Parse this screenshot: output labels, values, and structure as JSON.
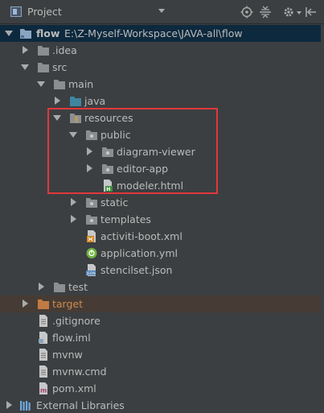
{
  "header": {
    "title": "Project",
    "tools": [
      "target-icon",
      "collapse-icon",
      "gear-icon",
      "hide-icon"
    ]
  },
  "tree": [
    {
      "label": "flow",
      "path": "E:\\Z-Myself-Workspace\\JAVA-all\\flow",
      "level": 0,
      "arrow": "down",
      "icon": "module-folder-icon"
    },
    {
      "label": ".idea",
      "level": 1,
      "arrow": "right",
      "icon": "folder-icon"
    },
    {
      "label": "src",
      "level": 1,
      "arrow": "down",
      "icon": "folder-icon"
    },
    {
      "label": "main",
      "level": 2,
      "arrow": "down",
      "icon": "folder-icon"
    },
    {
      "label": "java",
      "level": 3,
      "arrow": "right",
      "icon": "source-folder-icon"
    },
    {
      "label": "resources",
      "level": 3,
      "arrow": "down",
      "icon": "resources-folder-icon"
    },
    {
      "label": "public",
      "level": 4,
      "arrow": "down",
      "icon": "folder-icon"
    },
    {
      "label": "diagram-viewer",
      "level": 5,
      "arrow": "right",
      "icon": "folder-icon"
    },
    {
      "label": "editor-app",
      "level": 5,
      "arrow": "right",
      "icon": "folder-icon"
    },
    {
      "label": "modeler.html",
      "level": 5,
      "arrow": "none",
      "icon": "html-file-icon"
    },
    {
      "label": "static",
      "level": 4,
      "arrow": "right",
      "icon": "folder-icon"
    },
    {
      "label": "templates",
      "level": 4,
      "arrow": "right",
      "icon": "folder-icon"
    },
    {
      "label": "activiti-boot.xml",
      "level": 4,
      "arrow": "none",
      "icon": "xml-file-icon"
    },
    {
      "label": "application.yml",
      "level": 4,
      "arrow": "none",
      "icon": "spring-yml-icon"
    },
    {
      "label": "stencilset.json",
      "level": 4,
      "arrow": "none",
      "icon": "json-file-icon"
    },
    {
      "label": "test",
      "level": 2,
      "arrow": "right",
      "icon": "folder-icon"
    },
    {
      "label": "target",
      "level": 1,
      "arrow": "right",
      "icon": "excluded-folder-icon"
    },
    {
      "label": ".gitignore",
      "level": 1,
      "arrow": "none",
      "icon": "text-file-icon"
    },
    {
      "label": "flow.iml",
      "level": 1,
      "arrow": "none",
      "icon": "iml-file-icon"
    },
    {
      "label": "mvnw",
      "level": 1,
      "arrow": "none",
      "icon": "text-file-icon"
    },
    {
      "label": "mvnw.cmd",
      "level": 1,
      "arrow": "none",
      "icon": "text-file-icon"
    },
    {
      "label": "pom.xml",
      "level": 1,
      "arrow": "none",
      "icon": "maven-file-icon"
    },
    {
      "label": "External Libraries",
      "level": 0,
      "arrow": "right",
      "icon": "libraries-icon"
    }
  ]
}
